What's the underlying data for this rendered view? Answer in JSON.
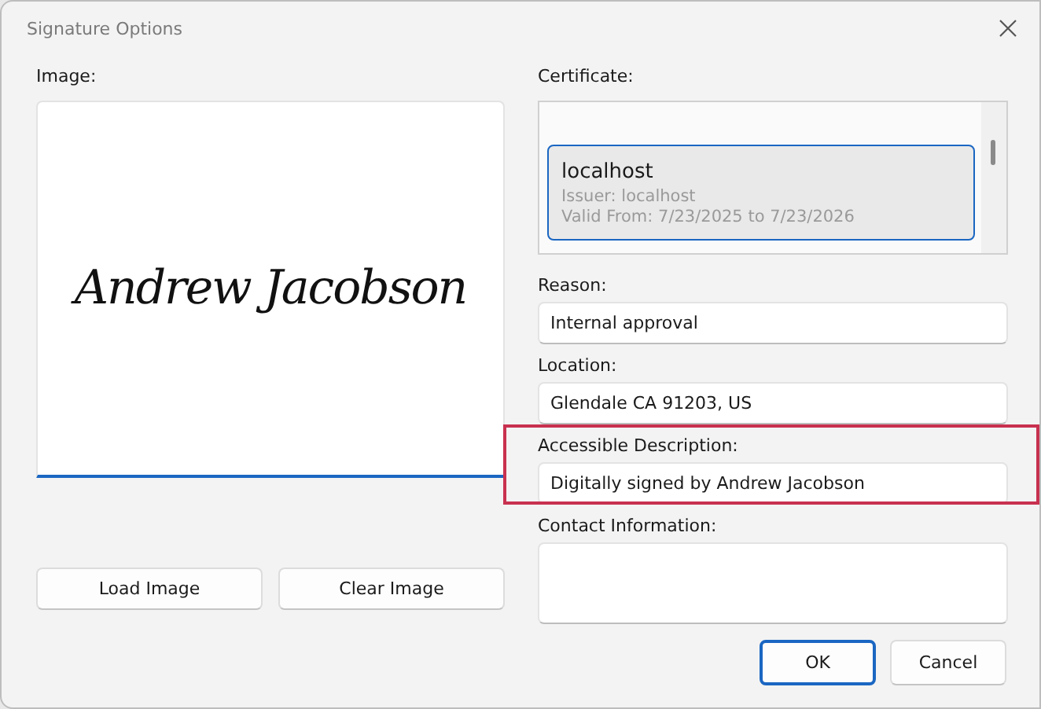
{
  "window": {
    "title": "Signature Options"
  },
  "image": {
    "label": "Image:",
    "signature": "Andrew Jacobson"
  },
  "image_buttons": [
    "Load Image",
    "Clear Image"
  ],
  "certificate": {
    "label": "Certificate:",
    "items": [
      {
        "name": "localhost",
        "issuer": "Issuer: localhost",
        "valid": "Valid From: 7/23/2025 to 7/23/2026",
        "selected": true
      }
    ]
  },
  "fields": [
    {
      "label": "Reason:",
      "value": "Internal approval",
      "highlighted": false,
      "kind": "line"
    },
    {
      "label": "Location:",
      "value": "Glendale CA 91203, US",
      "highlighted": false,
      "kind": "line"
    },
    {
      "label": "Accessible Description:",
      "value": "Digitally signed by Andrew Jacobson",
      "highlighted": true,
      "kind": "line"
    },
    {
      "label": "Contact Information:",
      "highlighted": false,
      "kind": "area"
    }
  ],
  "buttons": [
    {
      "label": "OK",
      "default": true
    },
    {
      "label": "Cancel",
      "default": false
    }
  ]
}
